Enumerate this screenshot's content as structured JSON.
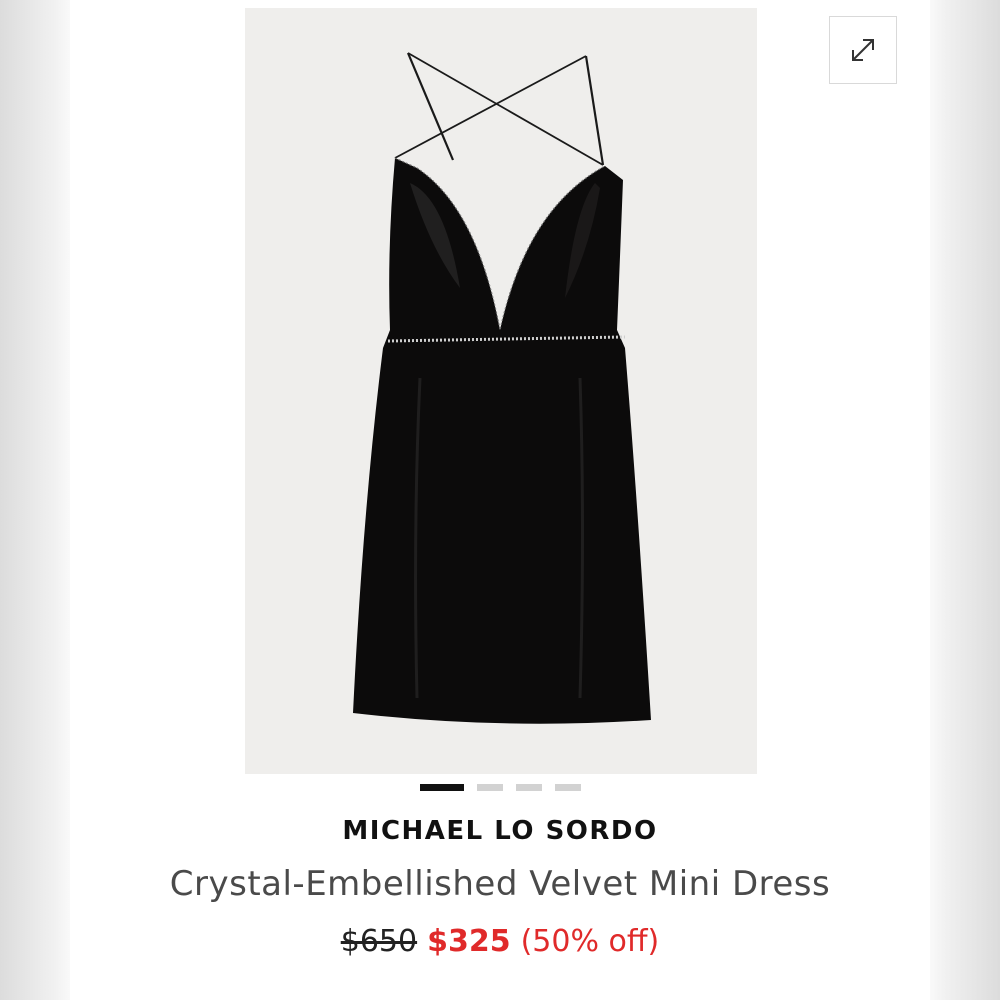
{
  "product": {
    "brand": "MICHAEL LO SORDO",
    "name": "Crystal-Embellished Velvet Mini Dress",
    "price_original": "$650",
    "price_sale": "$325",
    "discount": "(50% off)"
  },
  "gallery": {
    "image_count": 4,
    "active_index": 0,
    "expand_icon": "expand-arrows-icon"
  },
  "colors": {
    "sale_red": "#e02a2a",
    "dot_active": "#111111",
    "dot_inactive": "#d2d2d2",
    "photo_background": "#efeeec"
  }
}
